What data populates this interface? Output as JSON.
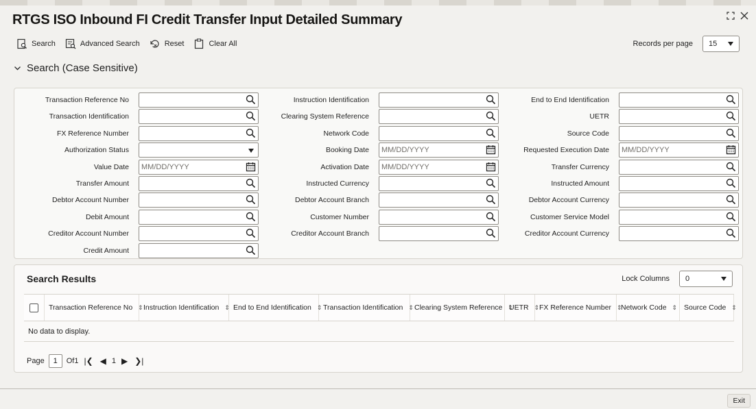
{
  "title": "RTGS ISO Inbound FI Credit Transfer Input Detailed Summary",
  "toolbar": {
    "search": "Search",
    "advanced_search": "Advanced Search",
    "reset": "Reset",
    "clear_all": "Clear All"
  },
  "records_per_page": {
    "label": "Records per page",
    "value": "15"
  },
  "search_section": {
    "label": "Search (Case Sensitive)"
  },
  "fields": {
    "col1": [
      {
        "label": "Transaction Reference No",
        "type": "lookup",
        "value": ""
      },
      {
        "label": "Transaction Identification",
        "type": "lookup",
        "value": ""
      },
      {
        "label": "FX Reference Number",
        "type": "lookup",
        "value": ""
      },
      {
        "label": "Authorization Status",
        "type": "select",
        "value": ""
      },
      {
        "label": "Value Date",
        "type": "date",
        "value": "MM/DD/YYYY"
      },
      {
        "label": "Transfer Amount",
        "type": "lookup",
        "value": ""
      },
      {
        "label": "Debtor Account Number",
        "type": "lookup",
        "value": ""
      },
      {
        "label": "Debit Amount",
        "type": "lookup",
        "value": ""
      },
      {
        "label": "Creditor Account Number",
        "type": "lookup",
        "value": ""
      },
      {
        "label": "Credit Amount",
        "type": "lookup",
        "value": ""
      }
    ],
    "col2": [
      {
        "label": "Instruction Identification",
        "type": "lookup",
        "value": ""
      },
      {
        "label": "Clearing System Reference",
        "type": "lookup",
        "value": ""
      },
      {
        "label": "Network Code",
        "type": "lookup",
        "value": ""
      },
      {
        "label": "Booking Date",
        "type": "date",
        "value": "MM/DD/YYYY"
      },
      {
        "label": "Activation Date",
        "type": "date",
        "value": "MM/DD/YYYY"
      },
      {
        "label": "Instructed Currency",
        "type": "lookup",
        "value": ""
      },
      {
        "label": "Debtor Account Branch",
        "type": "lookup",
        "value": ""
      },
      {
        "label": "Customer Number",
        "type": "lookup",
        "value": ""
      },
      {
        "label": "Creditor Account Branch",
        "type": "lookup",
        "value": ""
      }
    ],
    "col3": [
      {
        "label": "End to End Identification",
        "type": "lookup",
        "value": ""
      },
      {
        "label": "UETR",
        "type": "lookup",
        "value": ""
      },
      {
        "label": "Source Code",
        "type": "lookup",
        "value": ""
      },
      {
        "label": "Requested Execution Date",
        "type": "date",
        "value": "MM/DD/YYYY"
      },
      {
        "label": "Transfer Currency",
        "type": "lookup",
        "value": ""
      },
      {
        "label": "Instructed Amount",
        "type": "lookup",
        "value": ""
      },
      {
        "label": "Debtor Account Currency",
        "type": "lookup",
        "value": ""
      },
      {
        "label": "Customer Service Model",
        "type": "lookup",
        "value": ""
      },
      {
        "label": "Creditor Account Currency",
        "type": "lookup",
        "value": ""
      }
    ]
  },
  "results": {
    "title": "Search Results",
    "lock_columns": {
      "label": "Lock Columns",
      "value": "0"
    },
    "columns": [
      "Transaction Reference No",
      "Instruction Identification",
      "End to End Identification",
      "Transaction Identification",
      "Clearing System Reference",
      "UETR",
      "FX Reference Number",
      "Network Code",
      "Source Code"
    ],
    "empty_text": "No data to display.",
    "pager": {
      "page_label": "Page",
      "page": "1",
      "of_label": "Of",
      "total": "1",
      "current": "1"
    }
  },
  "footer": {
    "exit": "Exit"
  },
  "icons": {
    "search": "search-icon",
    "advanced_search": "advanced-search-icon",
    "reset": "reset-icon",
    "clear_all": "clipboard-icon",
    "lookup": "magnifier-icon",
    "calendar": "calendar-icon",
    "collapse": "chevron-down-icon",
    "maximize": "maximize-icon",
    "close": "close-icon"
  }
}
